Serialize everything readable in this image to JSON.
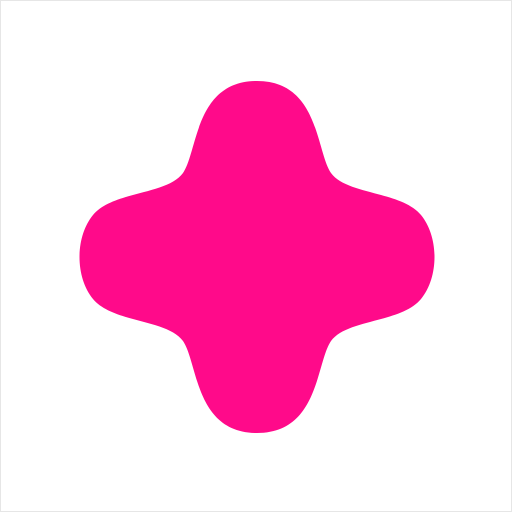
{
  "shape": {
    "icon": "rounded-cross-icon",
    "fill_color": "#FF0A8A"
  },
  "canvas": {
    "background_color": "#FFFFFF",
    "border_color": "#E6E6E6"
  }
}
